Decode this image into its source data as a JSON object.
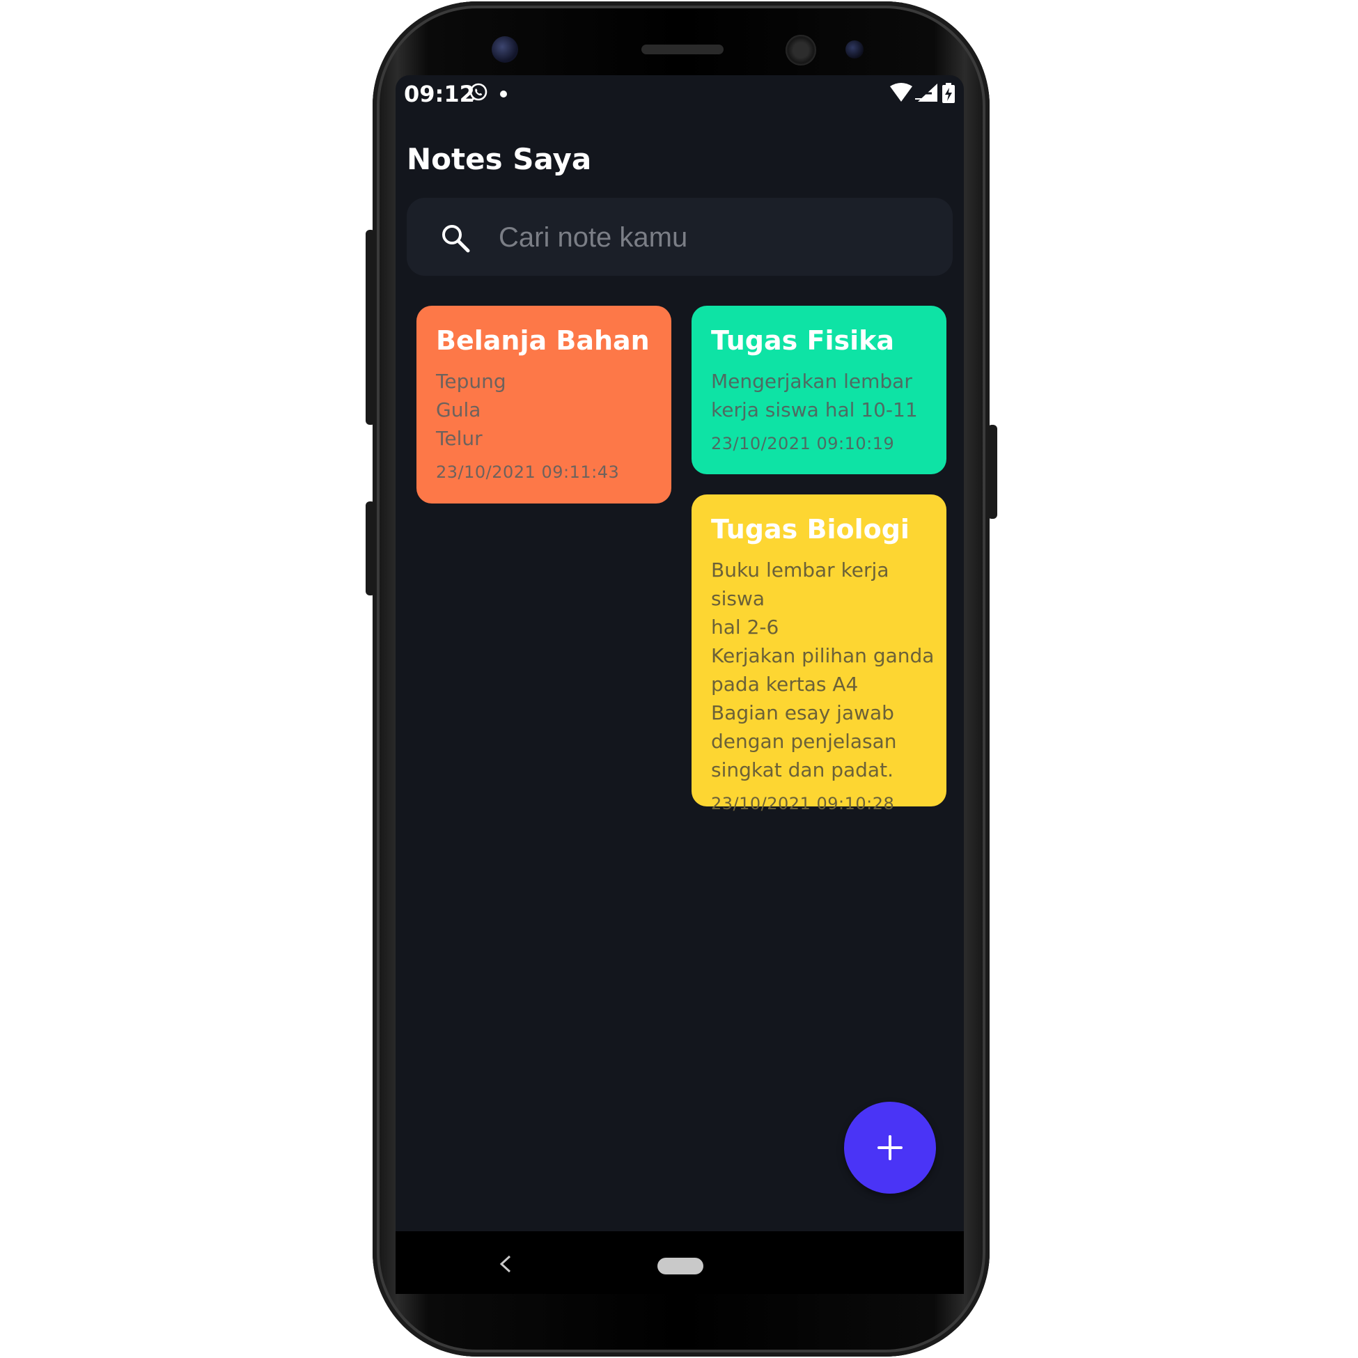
{
  "statusbar": {
    "time": "09:12",
    "icons": [
      "whatsapp-icon",
      "notification-dot-icon",
      "wifi-icon",
      "signal-icon",
      "battery-charging-icon"
    ]
  },
  "app": {
    "title": "Notes Saya"
  },
  "search": {
    "placeholder": "Cari note kamu",
    "value": ""
  },
  "notes": [
    {
      "title": "Belanja Bahan",
      "body": "Tepung\nGula\nTelur",
      "date": "23/10/2021 09:11:43",
      "color": "#fd7848"
    },
    {
      "title": "Tugas Fisika",
      "body": "Mengerjakan lembar\nkerja siswa hal 10-11",
      "date": "23/10/2021 09:10:19",
      "color": "#0ee3a5"
    },
    {
      "title": "Tugas Biologi",
      "body": "Buku lembar kerja siswa\nhal 2-6\nKerjakan pilihan ganda\npada kertas A4\nBagian esay jawab\ndengan penjelasan\nsingkat dan padat.",
      "date": "23/10/2021 09:10:28",
      "color": "#fdd632"
    }
  ],
  "fab": {
    "icon": "plus-icon",
    "color": "#4a34f6"
  },
  "navbar": {
    "icons": [
      "back-chevron-icon",
      "home-pill-icon"
    ]
  },
  "colors": {
    "background": "#13161d",
    "search_background": "#1b1f28",
    "accent": "#4a34f6"
  }
}
